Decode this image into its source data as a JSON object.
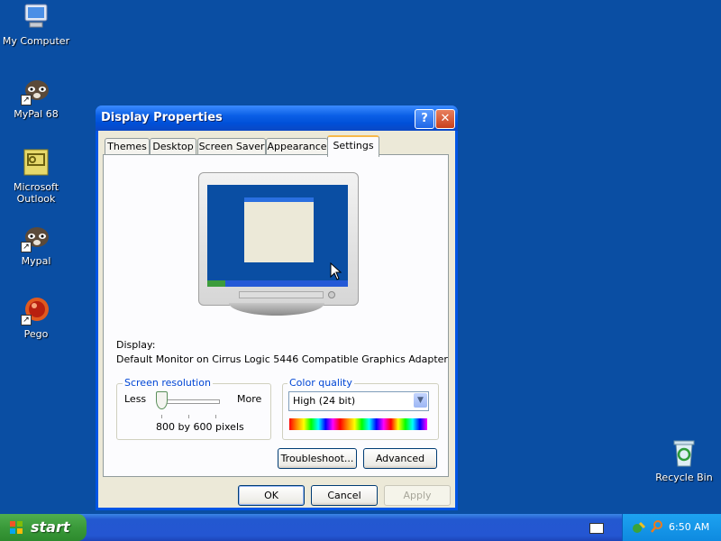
{
  "desktop": {
    "icons": [
      {
        "label": "My Computer"
      },
      {
        "label": "MyPal 68"
      },
      {
        "label": "Microsoft Outlook"
      },
      {
        "label": "Mypal"
      },
      {
        "label": "Pego"
      },
      {
        "label": "Recycle Bin"
      }
    ]
  },
  "window": {
    "title": "Display Properties",
    "help_glyph": "?",
    "close_glyph": "✕",
    "tabs": [
      {
        "label": "Themes"
      },
      {
        "label": "Desktop"
      },
      {
        "label": "Screen Saver"
      },
      {
        "label": "Appearance"
      },
      {
        "label": "Settings"
      }
    ],
    "active_tab": "Settings",
    "display_label": "Display:",
    "display_value": "Default Monitor on Cirrus Logic 5446 Compatible Graphics Adapter",
    "screen_resolution": {
      "legend": "Screen resolution",
      "less": "Less",
      "more": "More",
      "value_text": "800 by 600 pixels",
      "slider_position": 0
    },
    "color_quality": {
      "legend": "Color quality",
      "selected": "High (24 bit)"
    },
    "buttons": {
      "troubleshoot": "Troubleshoot...",
      "advanced": "Advanced",
      "ok": "OK",
      "cancel": "Cancel",
      "apply": "Apply"
    }
  },
  "taskbar": {
    "start_label": "start",
    "clock": "6:50 AM"
  },
  "colors": {
    "desktop": "#0a4ea3",
    "title_bar": "#0055e5",
    "taskbar": "#2456d2",
    "start_button": "#3a9a3a",
    "dialog_face": "#ece9d8"
  }
}
